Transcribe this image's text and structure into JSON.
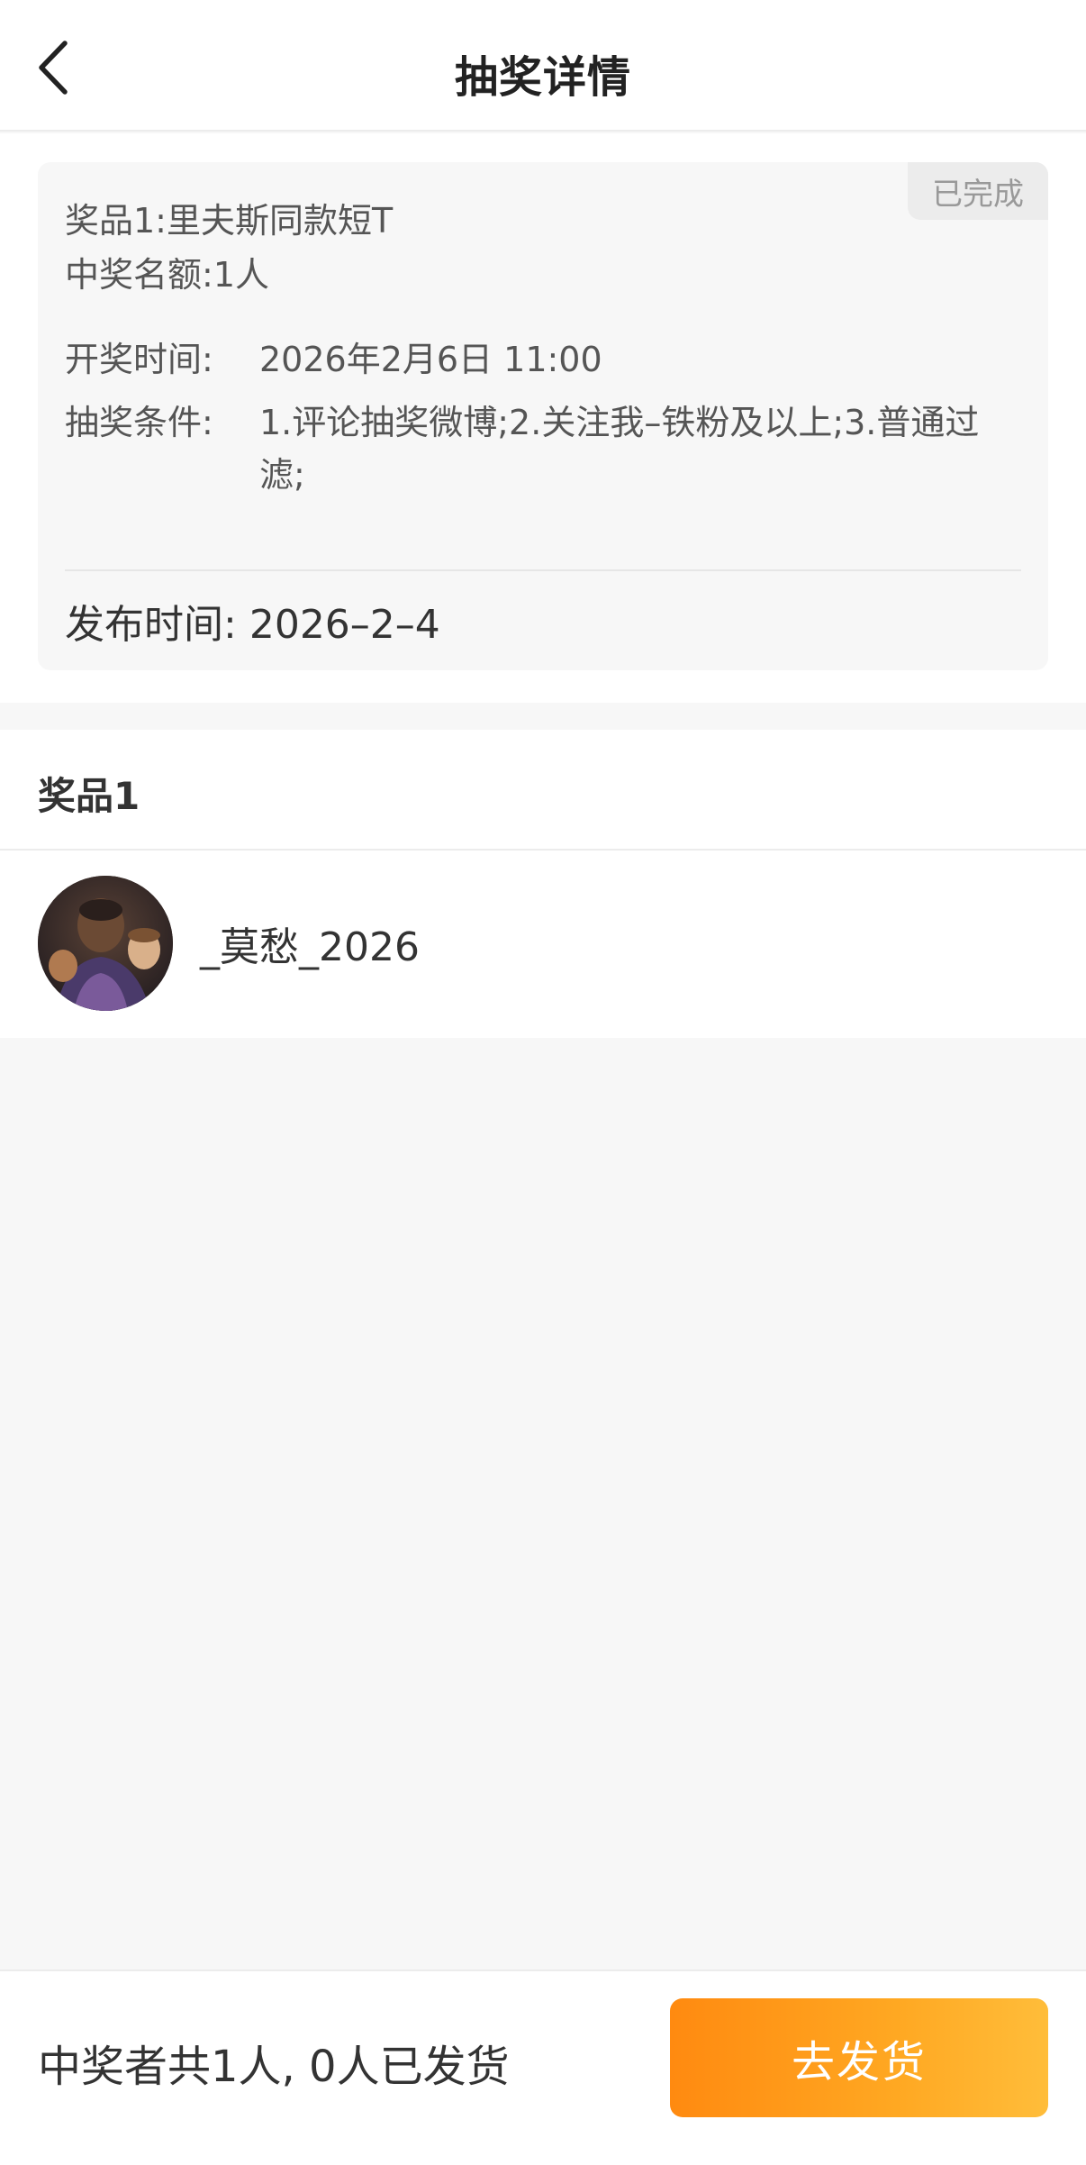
{
  "header": {
    "title": "抽奖详情",
    "back_icon": "chevron-left-icon"
  },
  "card": {
    "status": "已完成",
    "prize_label": "奖品1:",
    "prize_value": "里夫斯同款短T",
    "quota_label": "中奖名额:",
    "quota_value": "1人",
    "draw_time_label": "开奖时间:",
    "draw_time_value": "2026年2月6日 11:00",
    "conditions_label": "抽奖条件:",
    "conditions_value": "1.评论抽奖微博;2.关注我–铁粉及以上;3.普通过滤;",
    "publish_label": "发布时间:",
    "publish_value": "2026–2–4"
  },
  "winners": {
    "group_title": "奖品1",
    "items": [
      {
        "name": "_莫愁_2026",
        "avatar_icon": "user-avatar"
      }
    ]
  },
  "footer": {
    "summary": "中奖者共1人, 0人已发货",
    "ship_button_label": "去发货",
    "button_gradient": [
      "#ff8a10",
      "#ffbd3a"
    ]
  }
}
